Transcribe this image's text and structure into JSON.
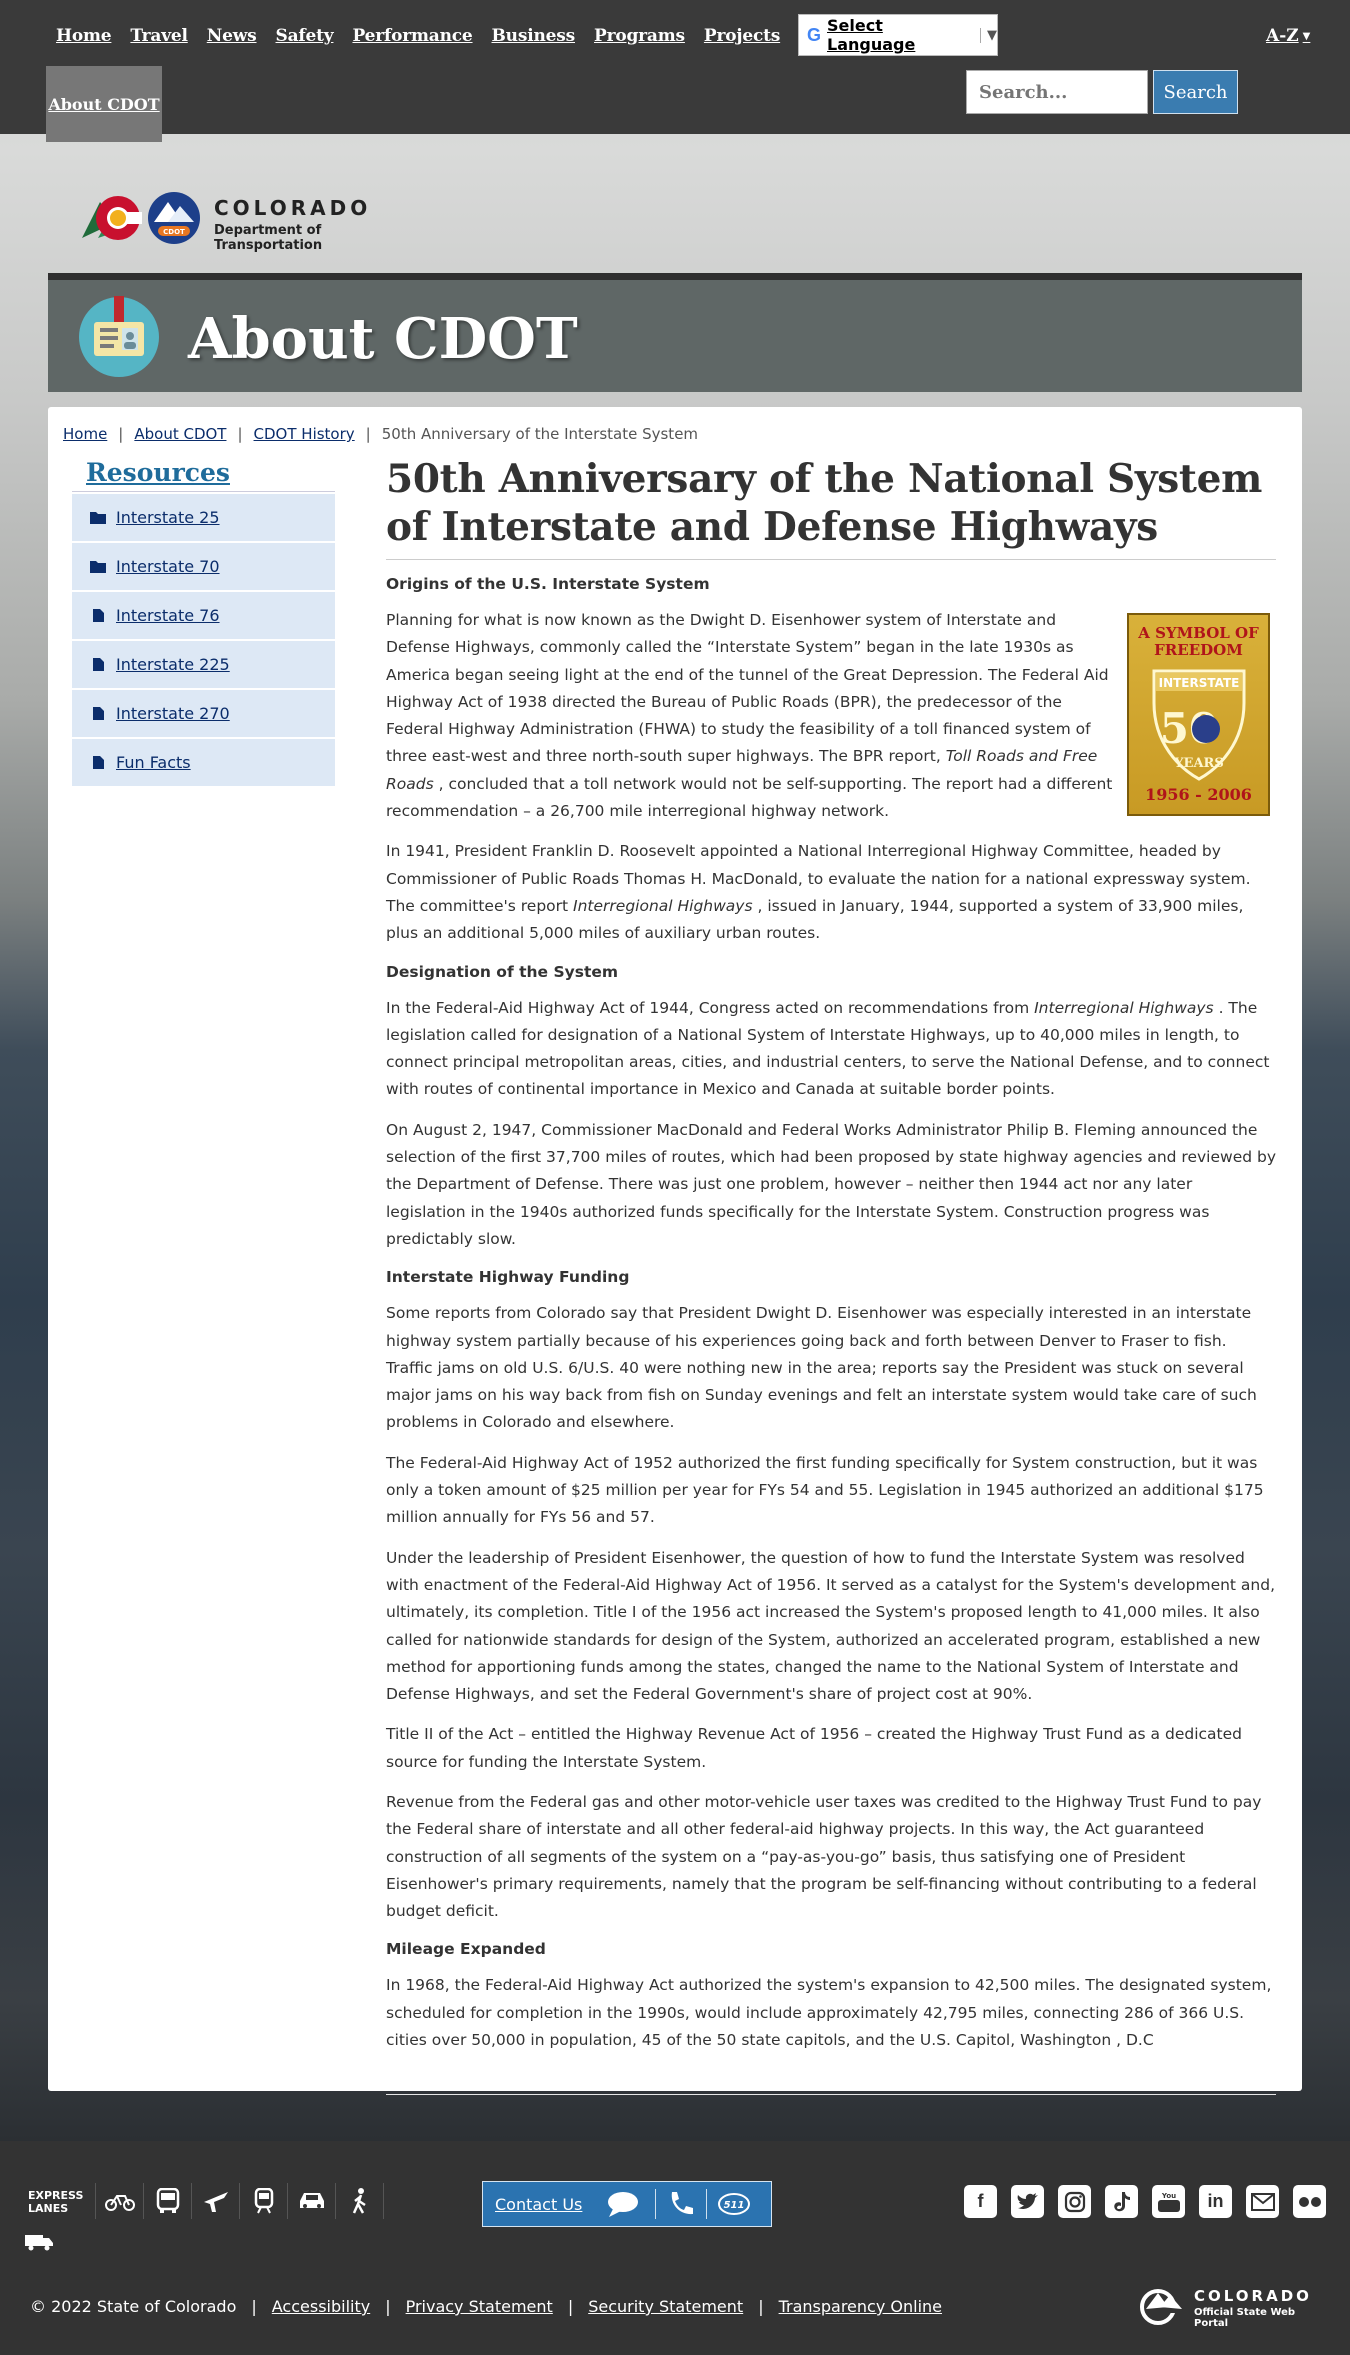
{
  "nav": {
    "links": [
      "Home",
      "Travel",
      "News",
      "Safety",
      "Performance",
      "Business",
      "Programs",
      "Projects"
    ],
    "active_tab": "About CDOT",
    "language_label": "Select Language",
    "az_label": "A-Z",
    "search_placeholder": "Search...",
    "search_button": "Search"
  },
  "logo": {
    "line1": "COLORADO",
    "line2": "Department of Transportation",
    "badge": "CDOT"
  },
  "banner": {
    "title": "About CDOT"
  },
  "breadcrumb": {
    "items": [
      "Home",
      "About CDOT",
      "CDOT History"
    ],
    "current": "50th Anniversary of the Interstate System"
  },
  "sidebar": {
    "heading": "Resources",
    "items": [
      {
        "label": "Interstate 25",
        "icon": "folder-icon"
      },
      {
        "label": "Interstate 70",
        "icon": "folder-icon"
      },
      {
        "label": "Interstate 76",
        "icon": "file-icon"
      },
      {
        "label": "Interstate 225",
        "icon": "file-icon"
      },
      {
        "label": "Interstate 270",
        "icon": "file-icon"
      },
      {
        "label": "Fun Facts",
        "icon": "file-icon"
      }
    ]
  },
  "article": {
    "title": "50th Anniversary of the National System of Interstate and Defense Highways",
    "badge_image": {
      "line1": "A SYMBOL OF FREEDOM",
      "line2": "INTERSTATE",
      "line3": "50",
      "line4": "YEARS",
      "line5": "1956 - 2006"
    },
    "s1_heading": "Origins of the U.S. Interstate System",
    "p1a": "Planning for what is now known as the Dwight D. Eisenhower system of Interstate and Defense Highways, commonly called the “Interstate System” began in the late 1930s as America began seeing light at the end of the tunnel of the Great Depression. The Federal Aid Highway Act of 1938 directed the Bureau of Public Roads (BPR), the predecessor of the Federal Highway Administration (FHWA) to study the feasibility of a toll financed system of three east-west and three north-south super highways. The BPR report, ",
    "p1_em": "Toll Roads and Free Roads",
    "p1b": " , concluded that a toll network would not be self-supporting. The report had a different recommendation – a 26,700 mile interregional highway network.",
    "p2a": "In 1941, President Franklin D. Roosevelt appointed a National Interregional Highway Committee, headed by Commissioner of Public Roads Thomas H. MacDonald, to evaluate the nation for a national expressway system. The committee's report ",
    "p2_em": "Interregional Highways",
    "p2b": " , issued in January, 1944, supported a system of 33,900 miles, plus an additional 5,000 miles of auxiliary urban routes.",
    "s2_heading": "Designation of the System",
    "p3a": "In the Federal-Aid Highway Act of 1944, Congress acted on recommendations from ",
    "p3_em": "Interregional Highways",
    "p3b": " . The legislation called for designation of a National System of Interstate Highways, up to 40,000 miles in length, to connect principal metropolitan areas, cities, and industrial centers, to serve the National Defense, and to connect with routes of continental importance in Mexico and Canada at suitable border points.",
    "p4": "On August 2, 1947, Commissioner MacDonald and Federal Works Administrator Philip B. Fleming announced the selection of the first 37,700 miles of routes, which had been proposed by state highway agencies and reviewed by the Department of Defense. There was just one problem, however – neither then 1944 act nor any later legislation in the 1940s authorized funds specifically for the Interstate System. Construction progress was predictably slow.",
    "s3_heading": "Interstate Highway Funding",
    "p5": "Some reports from Colorado say that President Dwight D. Eisenhower was especially interested in an interstate highway system partially because of his experiences going back and forth between Denver to Fraser to fish. Traffic jams on old U.S. 6/U.S. 40 were nothing new in the area; reports say the President was stuck on several major jams on his way back from fish on Sunday evenings and felt an interstate system would take care of such problems in Colorado and elsewhere.",
    "p6": "The Federal-Aid Highway Act of 1952 authorized the first funding specifically for System construction, but it was only a token amount of $25 million per year for FYs 54 and 55. Legislation in 1945 authorized an additional $175 million annually for FYs 56 and 57.",
    "p7": "Under the leadership of President Eisenhower, the question of how to fund the Interstate System was resolved with enactment of the Federal-Aid Highway Act of 1956. It served as a catalyst for the System's development and, ultimately, its completion. Title I of the 1956 act increased the System's proposed length to 41,000 miles. It also called for nationwide standards for design of the System, authorized an accelerated program, established a new method for apportioning funds among the states, changed the name to the National System of Interstate and Defense Highways, and set the Federal Government's share of project cost at 90%.",
    "p8": "Title II of the Act – entitled the Highway Revenue Act of 1956 – created the Highway Trust Fund as a dedicated source for funding the Interstate System.",
    "p9": "Revenue from the Federal gas and other motor-vehicle user taxes was credited to the Highway Trust Fund to pay the Federal share of interstate and all other federal-aid highway projects. In this way, the Act guaranteed construction of all segments of the system on a “pay-as-you-go” basis, thus satisfying one of President Eisenhower's primary requirements, namely that the program be self-financing without contributing to a federal budget deficit.",
    "s4_heading": "Mileage Expanded",
    "p10": "In 1968, the Federal-Aid Highway Act authorized the system's expansion to 42,500 miles. The designated system, scheduled for completion in the 1990s, would include approximately 42,795 miles, connecting 286 of 366 U.S. cities over 50,000 in population, 45 of the 50 state capitols, and the U.S. Capitol, Washington , D.C"
  },
  "footer": {
    "express_lanes_line1": "EXPRESS",
    "express_lanes_line2": "LANES",
    "contact_label": "Contact Us",
    "contact_511": "511",
    "copyright": "© 2022 State of Colorado",
    "links": [
      "Accessibility",
      "Privacy Statement",
      "Security Statement",
      "Transparency Online"
    ],
    "portal_line1": "COLORADO",
    "portal_line2": "Official State Web Portal"
  },
  "colors": {
    "nav_bg": "#3a3a3a",
    "banner_bg": "#5f6766",
    "link_blue": "#0b2d6b",
    "sidebar_item_bg": "#dde8f5",
    "resources_heading": "#1f6c9b",
    "search_button_bg": "#3a7cb0",
    "contact_bg": "#2b73b0",
    "footer_bg": "#333333"
  }
}
